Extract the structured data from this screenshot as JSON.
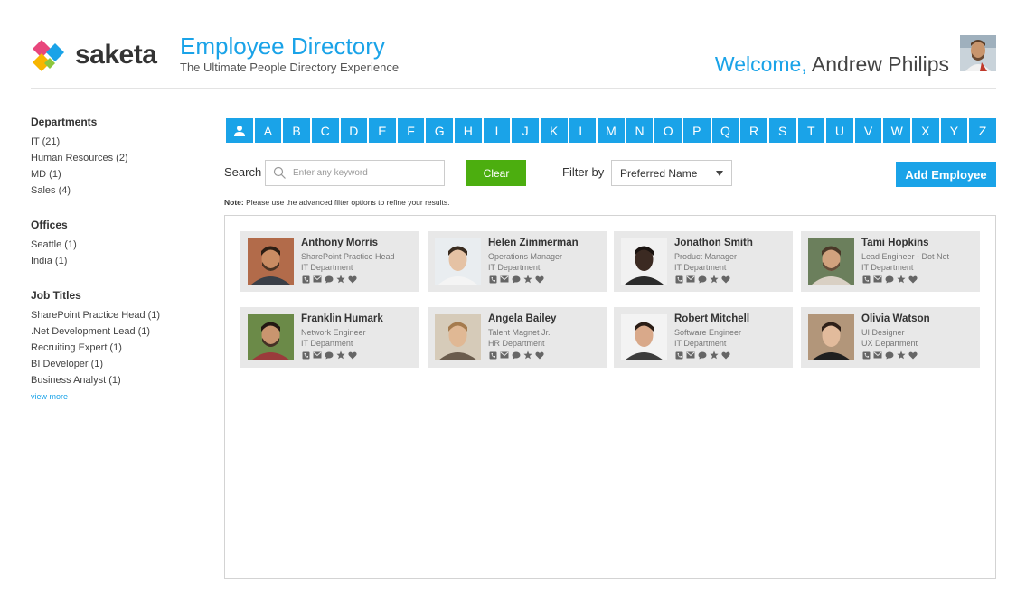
{
  "header": {
    "brand": "saketa",
    "title": "Employee Directory",
    "subtitle": "The Ultimate People Directory Experience",
    "welcome_prefix": "Welcome,",
    "user_name": "Andrew Philips"
  },
  "sidebar": {
    "departments": {
      "heading": "Departments",
      "items": [
        "IT (21)",
        "Human Resources (2)",
        "MD (1)",
        "Sales (4)"
      ]
    },
    "offices": {
      "heading": "Offices",
      "items": [
        "Seattle (1)",
        "India (1)"
      ]
    },
    "job_titles": {
      "heading": "Job Titles",
      "items": [
        "SharePoint Practice Head (1)",
        ".Net Development Lead (1)",
        "Recruiting Expert (1)",
        "BI Developer (1)",
        "Business Analyst (1)"
      ],
      "more": "view more"
    }
  },
  "alphabet": [
    "A",
    "B",
    "C",
    "D",
    "E",
    "F",
    "G",
    "H",
    "I",
    "J",
    "K",
    "L",
    "M",
    "N",
    "O",
    "P",
    "Q",
    "R",
    "S",
    "T",
    "U",
    "V",
    "W",
    "X",
    "Y",
    "Z"
  ],
  "alphabet_all_icon": "person-icon",
  "search": {
    "label": "Search",
    "placeholder": "Enter any keyword",
    "clear_label": "Clear",
    "filter_label": "Filter by",
    "filter_value": "Preferred Name",
    "add_label": "Add Employee",
    "note_bold": "Note:",
    "note_text": "Please use the advanced filter options to refine your results."
  },
  "employees": [
    {
      "name": "Anthony Morris",
      "title": "SharePoint Practice Head",
      "department": "IT Department"
    },
    {
      "name": "Helen Zimmerman",
      "title": "Operations Manager",
      "department": "IT Department"
    },
    {
      "name": "Jonathon Smith",
      "title": "Product Manager",
      "department": "IT Department"
    },
    {
      "name": "Tami Hopkins",
      "title": "Lead Engineer - Dot Net",
      "department": "IT Department"
    },
    {
      "name": "Franklin Humark",
      "title": "Network Engineer",
      "department": "IT Department"
    },
    {
      "name": "Angela Bailey",
      "title": "Talent Magnet Jr.",
      "department": "HR Department"
    },
    {
      "name": "Robert Mitchell",
      "title": "Software Engineer",
      "department": "IT Department"
    },
    {
      "name": "Olivia Watson",
      "title": "UI Designer",
      "department": "UX Department"
    }
  ],
  "card_action_icons": [
    "phone-icon",
    "mail-icon",
    "chat-icon",
    "star-icon",
    "heart-icon"
  ],
  "colors": {
    "accent": "#1aa3e8",
    "clear_button": "#4cae0f",
    "card_background": "#e8e8e8"
  }
}
